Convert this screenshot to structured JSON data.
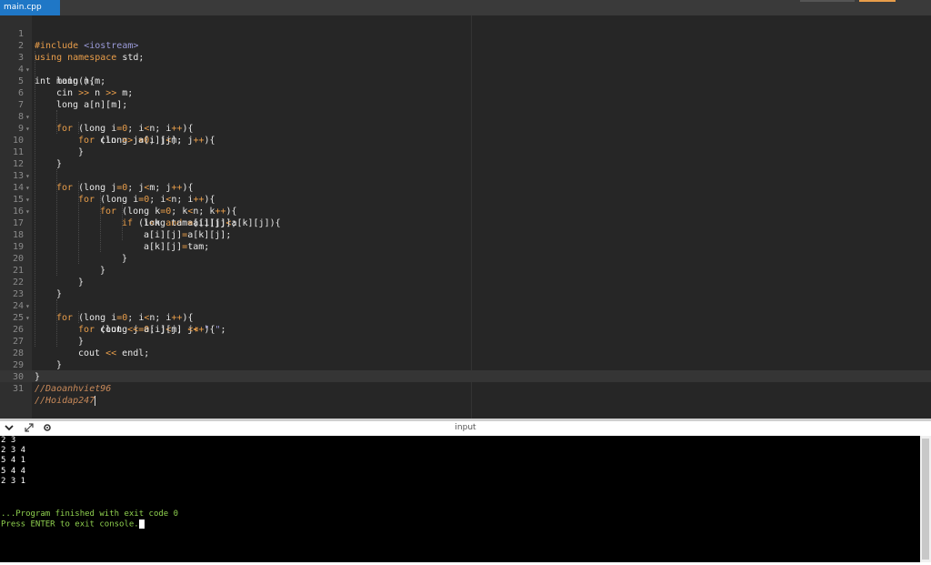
{
  "tab": {
    "filename": "main.cpp"
  },
  "colors": {
    "tab_active": "#1f77c6",
    "keyword": "#e89d4a",
    "string": "#9a9ad8",
    "comment": "#c98a5a",
    "console_green": "#8fd14f"
  },
  "icons": {
    "collapse": "chevron-down-icon",
    "expand": "expand-arrows-icon",
    "settings": "gear-icon"
  },
  "editor": {
    "line_numbers": [
      "1",
      "2",
      "3",
      "4",
      "5",
      "6",
      "7",
      "8",
      "9",
      "10",
      "11",
      "12",
      "13",
      "14",
      "15",
      "16",
      "17",
      "18",
      "19",
      "20",
      "21",
      "22",
      "23",
      "24",
      "25",
      "26",
      "27",
      "28",
      "29",
      "30",
      "31"
    ],
    "code": {
      "l1": {
        "a": "#include ",
        "b": "<iostream>"
      },
      "l2": {
        "a": "using namespace",
        "b": " std;"
      },
      "l3": {
        "a": "int main(){"
      },
      "l4": {
        "a": "long n,m;"
      },
      "l5": {
        "a": "cin ",
        "b": ">>",
        "c": " n ",
        "d": ">>",
        "e": " m;"
      },
      "l6": {
        "a": "long a[n][m];"
      },
      "l7": {
        "a": "for",
        "b": " (long i",
        "c": "=0",
        "d": "; i",
        "e": "<",
        "f": "n; i",
        "g": "++",
        "h": "){"
      },
      "l8": {
        "a": "for",
        "b": " (long j",
        "c": "=0",
        "d": "; j",
        "e": "<",
        "f": "m; j",
        "g": "++",
        "h": "){"
      },
      "l9": {
        "a": "cin ",
        "b": ">>",
        "c": " a[i][j];"
      },
      "l10": {
        "a": "}"
      },
      "l11": {
        "a": "}"
      },
      "l12": {
        "a": "for",
        "b": " (long j",
        "c": "=0",
        "d": "; j",
        "e": "<",
        "f": "m; j",
        "g": "++",
        "h": "){"
      },
      "l13": {
        "a": "for",
        "b": " (long i",
        "c": "=0",
        "d": "; i",
        "e": "<",
        "f": "n; i",
        "g": "++",
        "h": "){"
      },
      "l14": {
        "a": "for",
        "b": " (long k",
        "c": "=0",
        "d": "; k",
        "e": "<",
        "f": "n; k",
        "g": "++",
        "h": "){"
      },
      "l15": {
        "a": "if",
        "b": " (i",
        "c": "<",
        "d": "k ",
        "e": "and",
        "f": " a[i][j]",
        "g": "<",
        "h": "a[k][j]){"
      },
      "l16": {
        "a": "long tam",
        "b": "=",
        "c": "a[i][j];"
      },
      "l17": {
        "a": "a[i][j]",
        "b": "=",
        "c": "a[k][j];"
      },
      "l18": {
        "a": "a[k][j]",
        "b": "=",
        "c": "tam;"
      },
      "l19": {
        "a": "}"
      },
      "l20": {
        "a": "}"
      },
      "l21": {
        "a": "}"
      },
      "l22": {
        "a": "}"
      },
      "l23": {
        "a": "for",
        "b": " (long i",
        "c": "=0",
        "d": "; i",
        "e": "<",
        "f": "n; i",
        "g": "++",
        "h": "){"
      },
      "l24": {
        "a": "for",
        "b": " (long j",
        "c": "=0",
        "d": "; j",
        "e": "<",
        "f": "m; j",
        "g": "++",
        "h": "){"
      },
      "l25": {
        "a": "cout ",
        "b": "<<",
        "c": " a[i][j] ",
        "d": "<<",
        "e": " \" \"",
        "f": ";"
      },
      "l26": {
        "a": "}"
      },
      "l27": {
        "a": "cout ",
        "b": "<<",
        "c": " endl;"
      },
      "l28": {
        "a": "}"
      },
      "l29": {
        "a": "}"
      },
      "l30": {
        "a": "//Daoanhviet96"
      },
      "l31": {
        "a": "//Hoidap247"
      }
    }
  },
  "console": {
    "title": "input",
    "output_lines": [
      "2 3",
      "2 3 4",
      "5 4 1",
      "5 4 4",
      "2 3 1"
    ],
    "finished_message": "...Program finished with exit code 0",
    "exit_prompt": "Press ENTER to exit console."
  }
}
